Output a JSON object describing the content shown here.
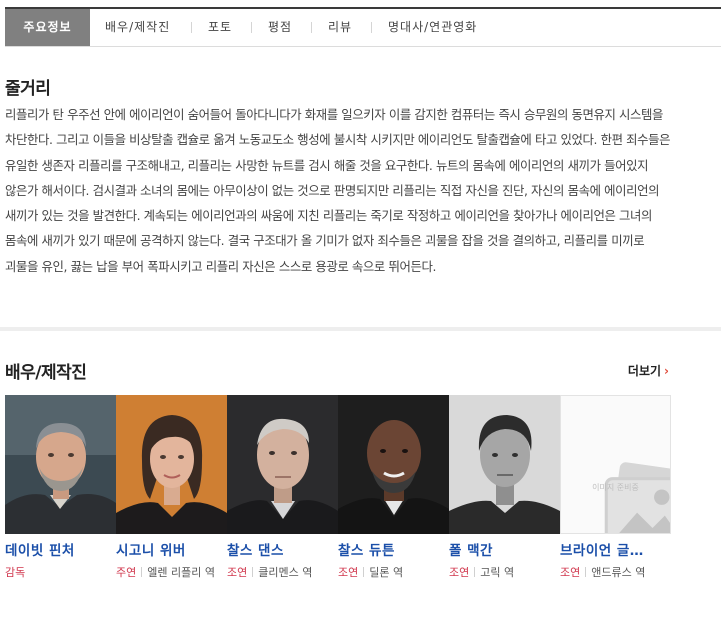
{
  "tabs": [
    {
      "label": "주요정보",
      "active": true
    },
    {
      "label": "배우/제작진",
      "active": false
    },
    {
      "label": "포토",
      "active": false
    },
    {
      "label": "평점",
      "active": false
    },
    {
      "label": "리뷰",
      "active": false
    },
    {
      "label": "명대사/연관영화",
      "active": false
    }
  ],
  "synopsis": {
    "title": "줄거리",
    "text": "리플리가 탄 우주선 안에 에이리언이 숨어들어 돌아다니다가 화재를 일으키자 이를 감지한 컴퓨터는 즉시 승무원의 동면유지 시스템을 차단한다. 그리고 이들을 비상탈출 캡슐로 옮겨 노동교도소 행성에 불시착 시키지만 에이리언도 탈출캡슐에 타고 있었다. 한편 죄수들은 유일한 생존자 리플리를 구조해내고, 리플리는 사망한 뉴트를 검시 해줄 것을 요구한다. 뉴트의 몸속에 에이리언의 새끼가 들어있지 않은가 해서이다. 검시결과 소녀의 몸에는 아무이상이 없는 것으로 판명되지만 리플리는 직접 자신을 진단, 자신의 몸속에 에이리언의 새끼가 있는 것을 발견한다. 계속되는 에이리언과의 싸움에 지친 리플리는 죽기로 작정하고 에이리언을 찾아가나 에이리언은 그녀의 몸속에 새끼가 있기 때문에 공격하지 않는다. 결국 구조대가 올 기미가 없자 죄수들은 괴물을 잡을 것을 결의하고, 리플리를 미끼로 괴물을 유인, 끓는 납을 부어 폭파시키고 리플리 자신은 스스로 용광로 속으로 뛰어든다."
  },
  "cast_section": {
    "title": "배우/제작진",
    "more_label": "더보기",
    "more_arrow": "›"
  },
  "cast": [
    {
      "name": "데이빗 핀처",
      "type": "감독",
      "role": "",
      "photo": "portrait-1"
    },
    {
      "name": "시고니 위버",
      "type": "주연",
      "role": "엘렌 리플리 역",
      "photo": "portrait-2"
    },
    {
      "name": "찰스 댄스",
      "type": "조연",
      "role": "클리멘스 역",
      "photo": "portrait-3"
    },
    {
      "name": "찰스 듀튼",
      "type": "조연",
      "role": "딜론 역",
      "photo": "portrait-4"
    },
    {
      "name": "폴 맥간",
      "type": "조연",
      "role": "고릭 역",
      "photo": "portrait-5"
    },
    {
      "name": "브라이언 글…",
      "type": "조연",
      "role": "앤드류스 역",
      "photo": "placeholder"
    }
  ],
  "placeholder_text": "이미지 준비중",
  "colors": {
    "active_tab_bg": "#808080",
    "name_link": "#1b4fa9",
    "role_type": "#d0364c",
    "more_arrow": "#e04c3b"
  }
}
